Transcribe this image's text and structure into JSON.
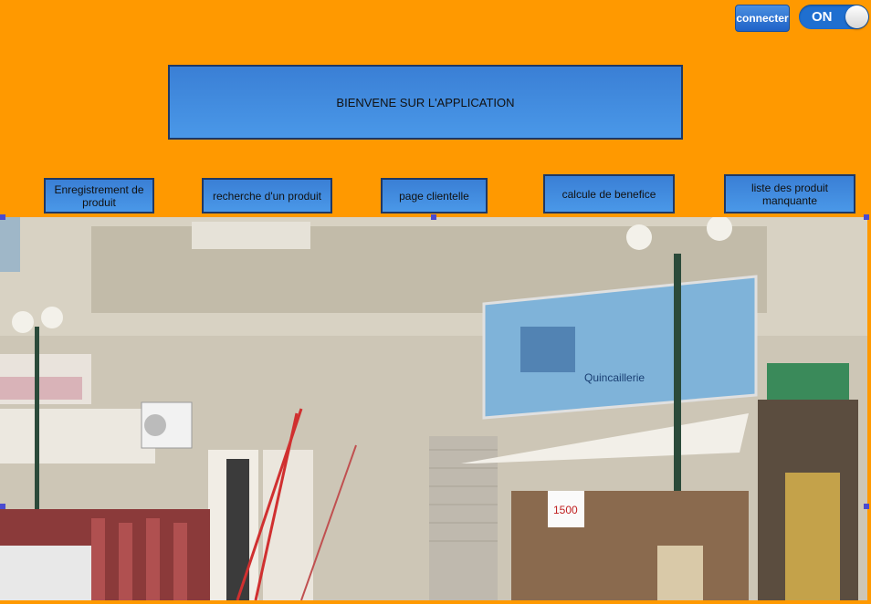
{
  "topbar": {
    "connect_label": "connecter",
    "toggle_label": "ON",
    "toggle_state": "on"
  },
  "banner": {
    "title": "BIENVENE SUR L'APPLICATION"
  },
  "nav": {
    "enregistrement": "Enregistrement de produit",
    "recherche": "recherche d'un produit",
    "clientele": "page clientelle",
    "benefice": "calcule de benefice",
    "manquante": "liste des produit manquante"
  },
  "photo": {
    "sign_text": "Quincaillerie",
    "price_tag": "1500"
  }
}
